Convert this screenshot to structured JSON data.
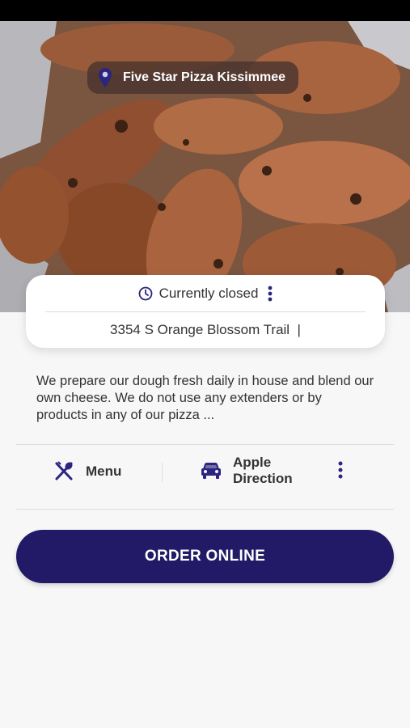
{
  "restaurant": {
    "name": "Five Star Pizza Kissimmee"
  },
  "info_card": {
    "status": "Currently closed",
    "address": "3354 S Orange Blossom Trail  |"
  },
  "description": "We prepare our dough fresh daily in house and blend our own cheese.  We do not use any extenders or by products in any of our pizza ...",
  "actions": {
    "menu_label": "Menu",
    "direction_label": "Apple Direction"
  },
  "order_button": {
    "label": "ORDER ONLINE"
  },
  "icons": {
    "location": "map-pin-icon",
    "status": "clock-icon",
    "more": "more-vertical-icon",
    "menu": "utensils-icon",
    "direction": "car-icon"
  },
  "colors": {
    "primary": "#221a66",
    "text": "#333333",
    "background": "#f7f7f7"
  }
}
